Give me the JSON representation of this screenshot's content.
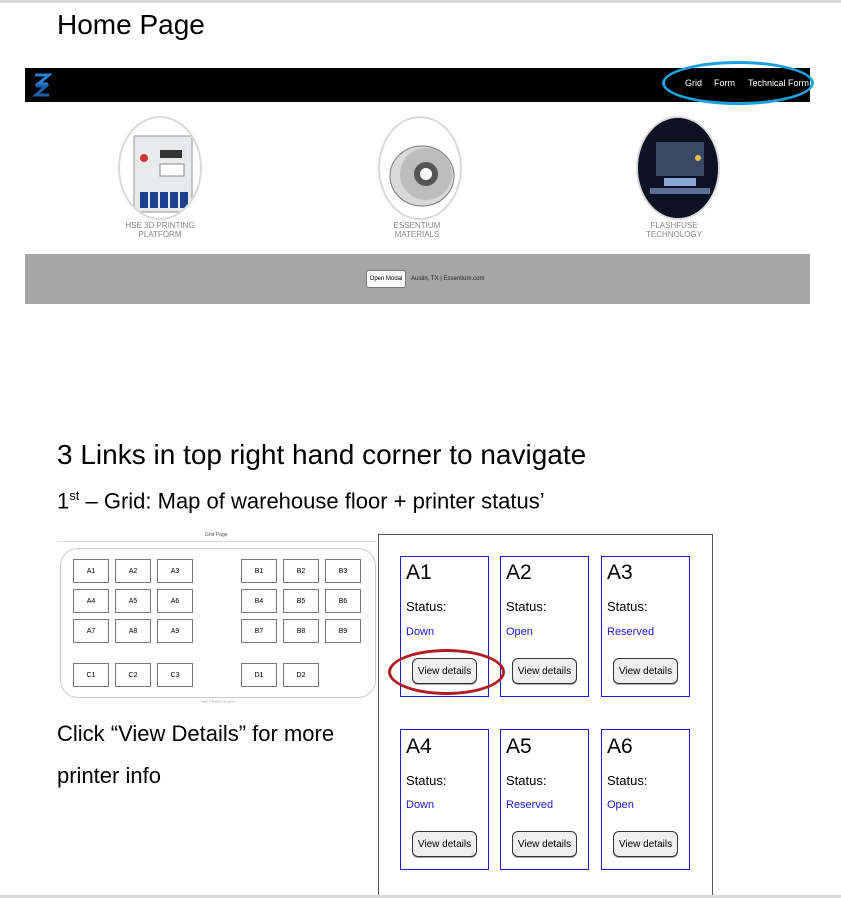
{
  "section1": {
    "title": "Home Page"
  },
  "site": {
    "nav": [
      "Grid",
      "Form",
      "Technical Form"
    ],
    "features": [
      {
        "line1": "HSE 3D PRINTING",
        "line2": "PLATFORM"
      },
      {
        "line1": "ESSENTIUM",
        "line2": "MATERIALS"
      },
      {
        "line1": "FLASHFUSE",
        "line2": "TECHNOLOGY"
      }
    ],
    "footer": {
      "button": "Open Modal",
      "text": "Austin, TX | Essentium.com"
    }
  },
  "section2": {
    "title": "3 Links in top right hand corner to navigate",
    "subtitle_prefix": "1",
    "subtitle_sup": "st",
    "subtitle_rest": " – Grid: Map of warehouse floor + printer status’",
    "click_note_line1": "Click “View Details” for more",
    "click_note_line2": "printer info"
  },
  "grid_map": {
    "title": "Grid Page",
    "rows": [
      [
        "A1",
        "A2",
        "A3",
        "B1",
        "B2",
        "B3"
      ],
      [
        "A4",
        "A5",
        "A6",
        "B4",
        "B5",
        "B6"
      ],
      [
        "A7",
        "A8",
        "A9",
        "B7",
        "B8",
        "B9"
      ],
      [
        "C1",
        "C2",
        "C3",
        "D1",
        "D2"
      ]
    ],
    "footer": "THE PRINTER APP"
  },
  "printers": [
    {
      "name": "A1",
      "status_label": "Status:",
      "status": "Down",
      "button": "View details"
    },
    {
      "name": "A2",
      "status_label": "Status:",
      "status": "Open",
      "button": "View details"
    },
    {
      "name": "A3",
      "status_label": "Status:",
      "status": "Reserved",
      "button": "View details"
    },
    {
      "name": "A4",
      "status_label": "Status:",
      "status": "Down",
      "button": "View details"
    },
    {
      "name": "A5",
      "status_label": "Status:",
      "status": "Reserved",
      "button": "View details"
    },
    {
      "name": "A6",
      "status_label": "Status:",
      "status": "Open",
      "button": "View details"
    }
  ],
  "colors": {
    "highlight_blue": "#1ea0dc",
    "highlight_red": "#b01c22",
    "status_blue": "#1a1adb"
  }
}
